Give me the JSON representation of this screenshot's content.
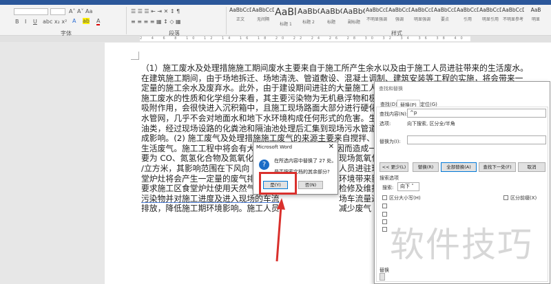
{
  "ribbon": {
    "groups": {
      "font": "字体",
      "paragraph": "段落",
      "styles": "样式"
    },
    "styles": [
      {
        "sample": "AaBbCcDı",
        "name": "正文"
      },
      {
        "sample": "AaBbCcDı",
        "name": "无间隔"
      },
      {
        "sample": "AaBl",
        "name": "标题 1"
      },
      {
        "sample": "AaBbC",
        "name": "标题 2"
      },
      {
        "sample": "AaBbC",
        "name": "标题"
      },
      {
        "sample": "AaBbC",
        "name": "副标题"
      },
      {
        "sample": "AaBbCcD",
        "name": "不明显强调"
      },
      {
        "sample": "AaBbCcD",
        "name": "强调"
      },
      {
        "sample": "AaBbCcD",
        "name": "明显强调"
      },
      {
        "sample": "AaBbCcD",
        "name": "要点"
      },
      {
        "sample": "AaBbCcD",
        "name": "引用"
      },
      {
        "sample": "AaBbCcD",
        "name": "明显引用"
      },
      {
        "sample": "AaBbCcDı",
        "name": "不明显参考"
      },
      {
        "sample": "AaB",
        "name": "明显"
      }
    ]
  },
  "document": {
    "lines": [
      "（1）施工废水及处理措施施工期间废水主要来自于施工所产生余水以及由于施工人员进驻带来的生活废水。",
      "在建筑施工期间，由于场地拆迁、场地清洗、管道敷设、混凝土调制、建筑安装等工程的实施，将会带来一",
      "定量的施工余水及废弃水。此外，由于建设期间进驻的大量施工人员日常生活将产",
      "施工废水的性质和化学组分来看，其主要污染物为无机悬浮物和极少量的油类等。",
      "吸附作用，会很快进入沉积箱中，且施工现场路面大部分进行硬化，施工废水通过",
      "水管网，几乎不会对地面水和地下水环境构成任何形式的危害。生活废水含有 DC",
      "油类，经过现场设路的化粪池和隔油池处理后汇集到现场污水管道后排入市政污水",
      "成影响。(2) 施工废气及处理措施施工废气的来源主要来自搅拌、运输车辆的尾气",
      "生活废气。施工工程中将会有大量的车辆进出厂址区，因而造成一定量的尾气排放",
      "要为 CO、氮氢化合物及氮氧化合物。",
      "/立方米，其影响范围在下风向 200 米",
      "堂炉灶将会产生一定量的废气排放。这",
      "要求施工区食堂炉灶使用天然气燃料，",
      "污染物并对施工进度及进入现场的车流",
      "排放，降低施工期环境影响。施工人员"
    ],
    "right_parts": [
      "现场氮氧化合",
      "人员进驻现场",
      "环境带来影响",
      "检修及维护，",
      "场车流量过大",
      "减少废气"
    ]
  },
  "find_dialog": {
    "title": "查找和替换",
    "tabs": [
      "查找(D)",
      "替换(P)",
      "定位(G)"
    ],
    "find_label": "查找内容(N):",
    "find_value": "^p",
    "options_label": "选项:",
    "options_value": "向下搜索, 区分全/半角",
    "replace_label": "替换为(I):",
    "replace_value": "",
    "buttons": {
      "less": "<< 更少(L)",
      "replace": "替换(R)",
      "replace_all": "全部替换(A)",
      "find_next": "查找下一处(F)",
      "cancel": "取消"
    },
    "search_options": "搜索选项",
    "search_label": "搜索:",
    "search_value": "向下",
    "match_case": "区分大小写(H)",
    "match_prefix": "区分前缀(X)",
    "replace_section": "替换"
  },
  "message_box": {
    "title": "Microsoft Word",
    "message": "在所选内容中替换了 27 处。",
    "question": "是否搜索文档的其余部分?",
    "yes": "是(Y)",
    "no": "否(N)"
  },
  "watermark": "软件技巧",
  "colors": {
    "accent": "#2b579a",
    "highlight": "#d9302c"
  }
}
